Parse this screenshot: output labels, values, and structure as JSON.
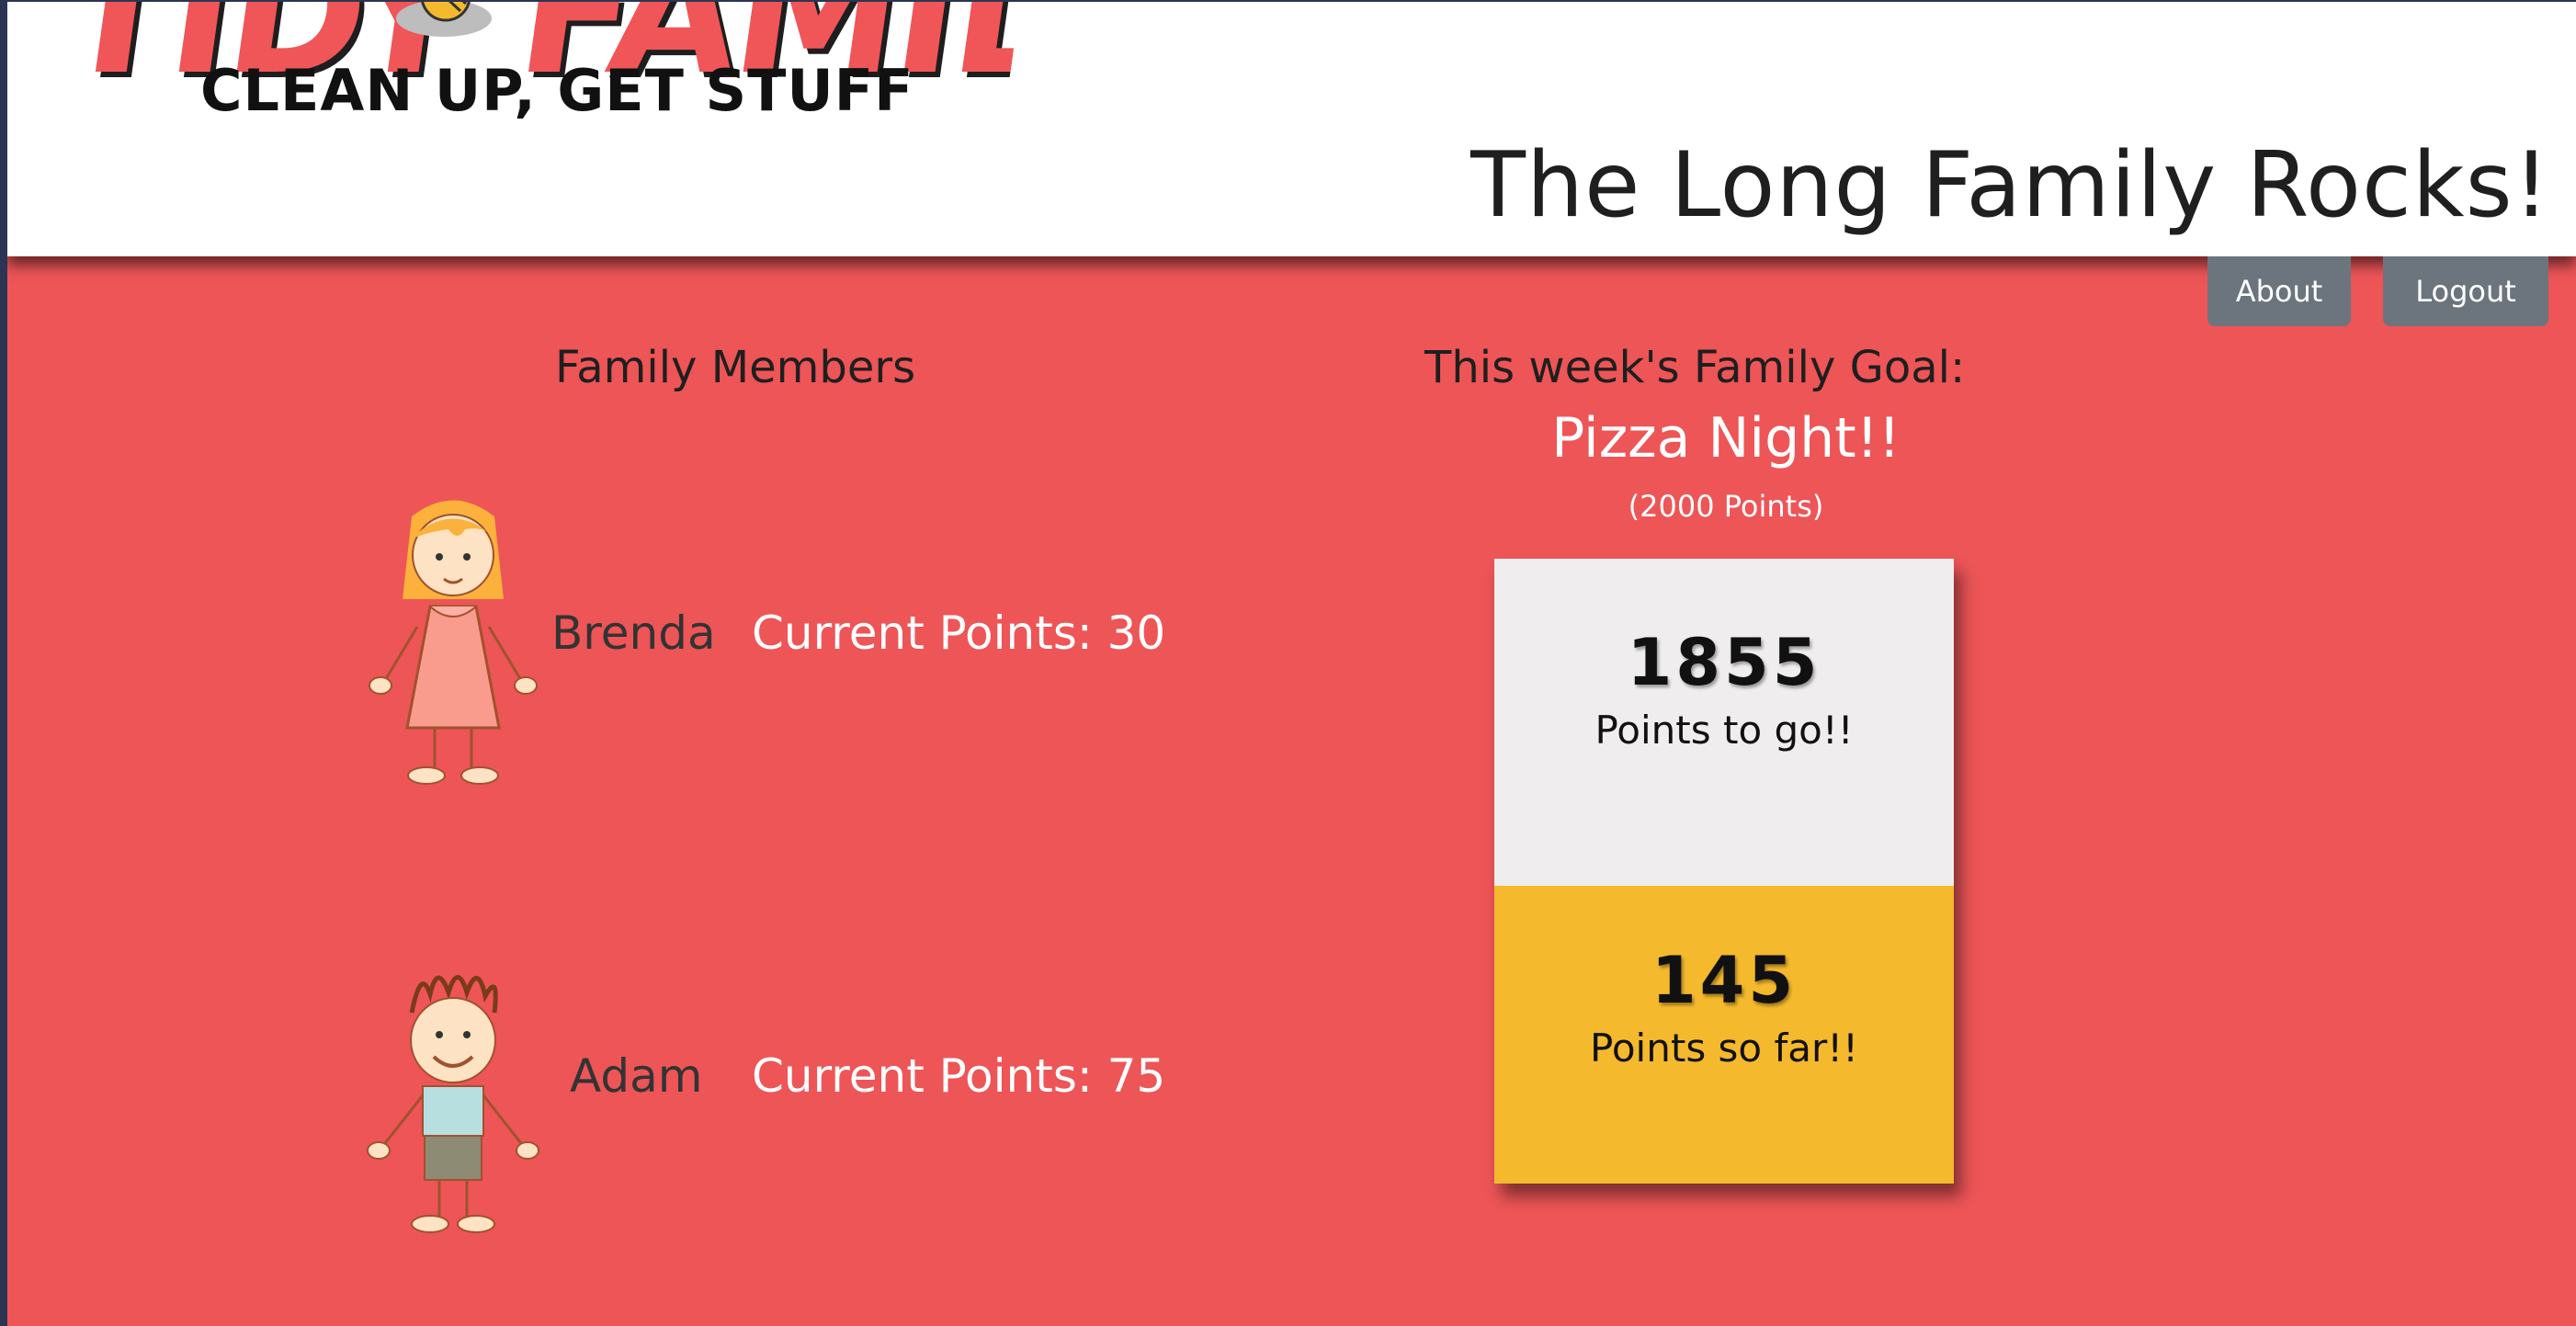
{
  "header": {
    "logo_wordmark": "TIDY FAMILY",
    "logo_tagline": "CLEAN UP, GET STUFF",
    "family_title": "The Long Family Rocks!"
  },
  "nav": {
    "about_label": "About",
    "logout_label": "Logout"
  },
  "members_section": {
    "heading": "Family Members",
    "members": [
      {
        "name": "Brenda",
        "points_text": "Current Points: 30",
        "points": 30,
        "avatar_icon": "girl-avatar-icon"
      },
      {
        "name": "Adam",
        "points_text": "Current Points: 75",
        "points": 75,
        "avatar_icon": "boy-avatar-icon"
      }
    ]
  },
  "goal": {
    "heading": "This week's Family Goal:",
    "name": "Pizza Night!!",
    "points_required": "(2000 Points)",
    "to_go_value": "1855",
    "to_go_label": "Points to go!!",
    "so_far_value": "145",
    "so_far_label": "Points so far!!"
  },
  "colors": {
    "page_background": "#ed5557",
    "header_background": "#ffffff",
    "button_background": "#6c757d",
    "meter_remaining": "#efeded",
    "meter_progress": "#f4b92c"
  }
}
